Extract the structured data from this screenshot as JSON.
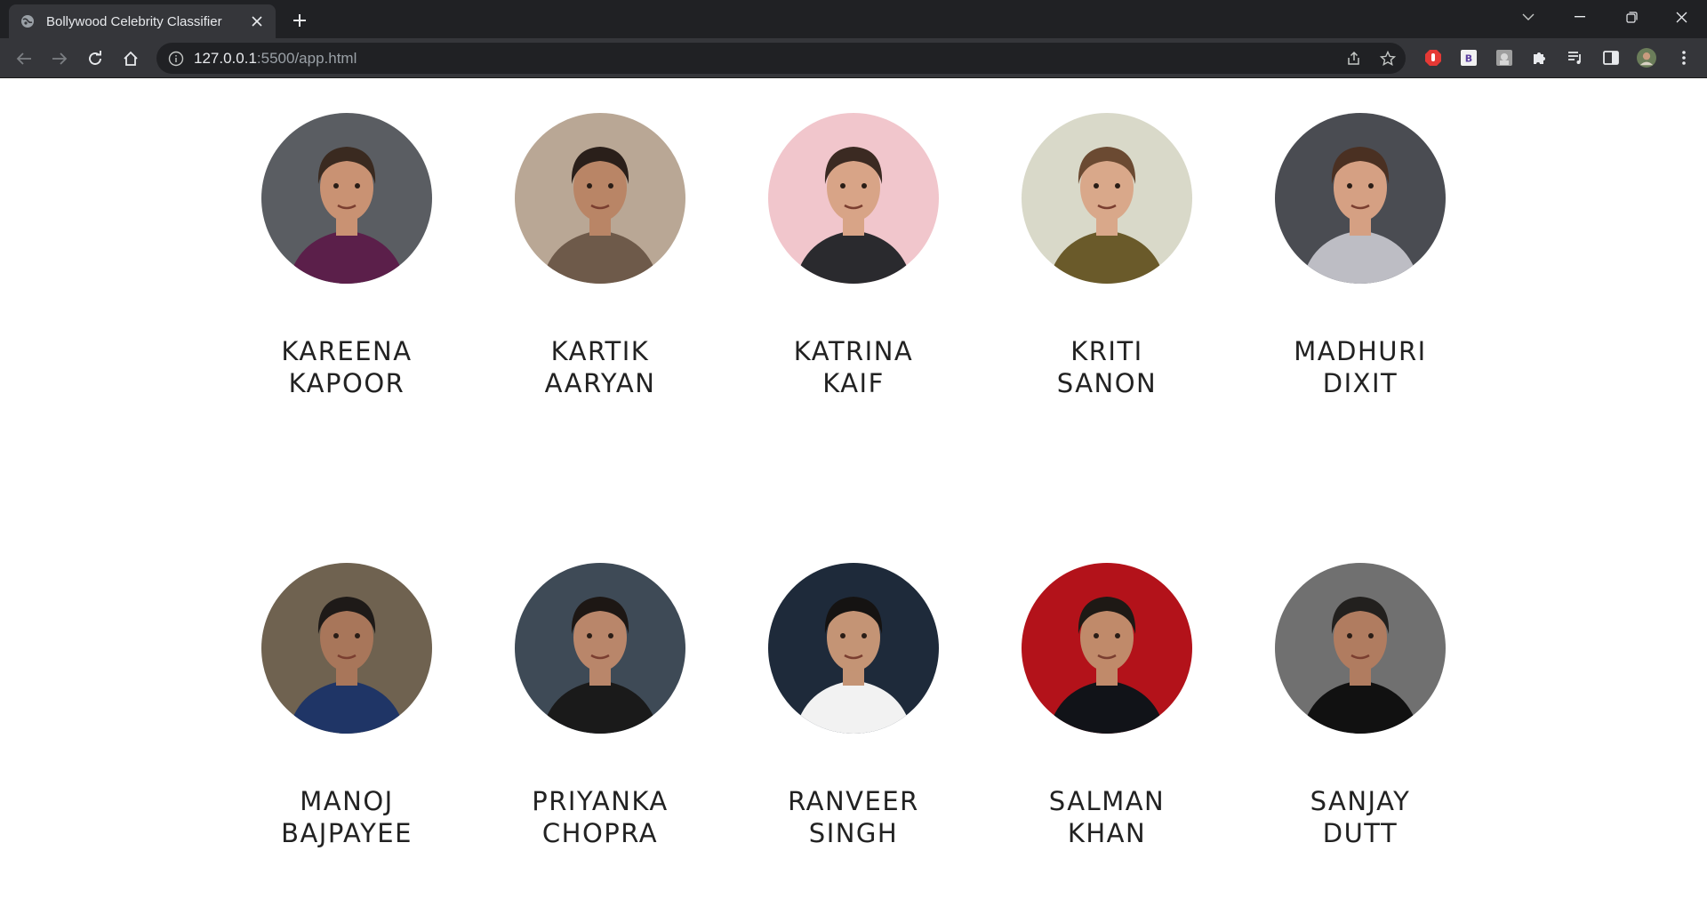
{
  "browser": {
    "tab_title": "Bollywood Celebrity Classifier",
    "url_host": "127.0.0.1",
    "url_rest": ":5500/app.html"
  },
  "celebrities": [
    {
      "first": "KAREENA",
      "last": "KAPOOR",
      "bg": "#5a5d62",
      "skin": "#c99273",
      "hair": "#3a2a20",
      "outfit": "#5b1f4a"
    },
    {
      "first": "KARTIK",
      "last": "AARYAN",
      "bg": "#b9a795",
      "skin": "#b98566",
      "hair": "#2a1f1a",
      "outfit": "#6e5a4a"
    },
    {
      "first": "KATRINA",
      "last": "KAIF",
      "bg": "#f1c6cc",
      "skin": "#d8a487",
      "hair": "#3b2a22",
      "outfit": "#2a2a2e"
    },
    {
      "first": "KRITI",
      "last": "SANON",
      "bg": "#d9d9c9",
      "skin": "#d9a88a",
      "hair": "#6b4a32",
      "outfit": "#6a5a2a"
    },
    {
      "first": "MADHURI",
      "last": "DIXIT",
      "bg": "#4a4c52",
      "skin": "#d5a083",
      "hair": "#4a3022",
      "outfit": "#bdbdc4"
    },
    {
      "first": "MANOJ",
      "last": "BAJPAYEE",
      "bg": "#6f6250",
      "skin": "#a8765a",
      "hair": "#1e1a18",
      "outfit": "#1f3566"
    },
    {
      "first": "PRIYANKA",
      "last": "CHOPRA",
      "bg": "#3e4a56",
      "skin": "#b9866a",
      "hair": "#1d1714",
      "outfit": "#1a1a1a"
    },
    {
      "first": "RANVEER",
      "last": "SINGH",
      "bg": "#1e2a3a",
      "skin": "#c49475",
      "hair": "#151312",
      "outfit": "#f2f2f2"
    },
    {
      "first": "SALMAN",
      "last": "KHAN",
      "bg": "#b3121a",
      "skin": "#c08a6a",
      "hair": "#1e1915",
      "outfit": "#111318"
    },
    {
      "first": "SANJAY",
      "last": "DUTT",
      "bg": "#707070",
      "skin": "#b07c60",
      "hair": "#22201e",
      "outfit": "#111111"
    }
  ]
}
